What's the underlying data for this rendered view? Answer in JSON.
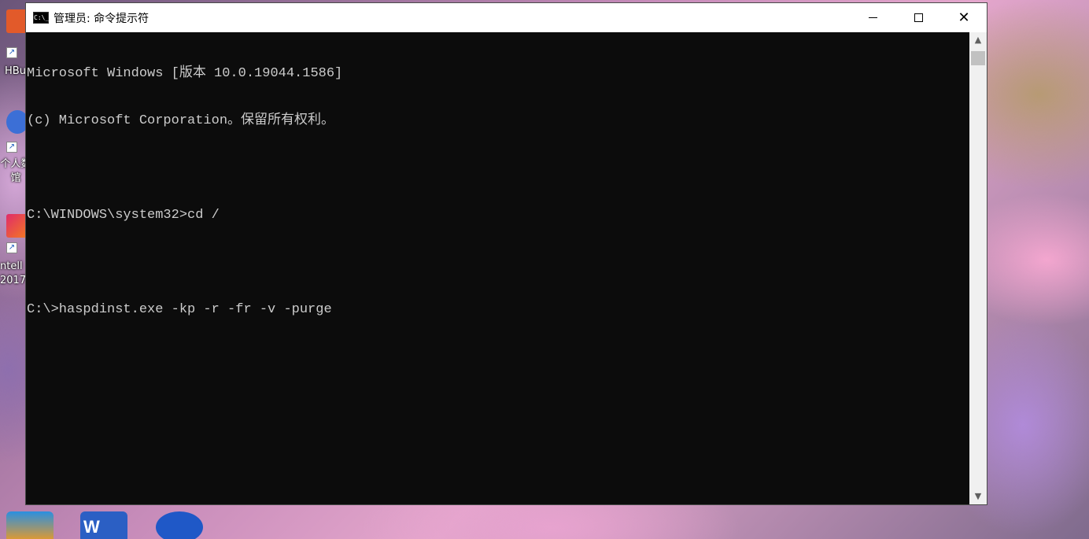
{
  "window": {
    "title": "管理员: 命令提示符",
    "icon_text": "C:\\_"
  },
  "console": {
    "lines": [
      "Microsoft Windows [版本 10.0.19044.1586]",
      "(c) Microsoft Corporation。保留所有权利。",
      "",
      "C:\\WINDOWS\\system32>cd /",
      "",
      "C:\\>haspdinst.exe -kp -r -fr -v -purge"
    ]
  },
  "desktop_icons": [
    {
      "label": "HBu",
      "icon": "hbuilder-icon",
      "color": "#e25a2a"
    },
    {
      "label": "个人数\n馆",
      "icon": "personal-library-icon",
      "color": "#3c6fd6"
    },
    {
      "label": "ntell\n2017",
      "icon": "intellij-icon",
      "color": "#e02b6a"
    }
  ],
  "colors": {
    "console_bg": "#0c0c0c",
    "console_fg": "#cccccc",
    "titlebar_bg": "#ffffff"
  }
}
